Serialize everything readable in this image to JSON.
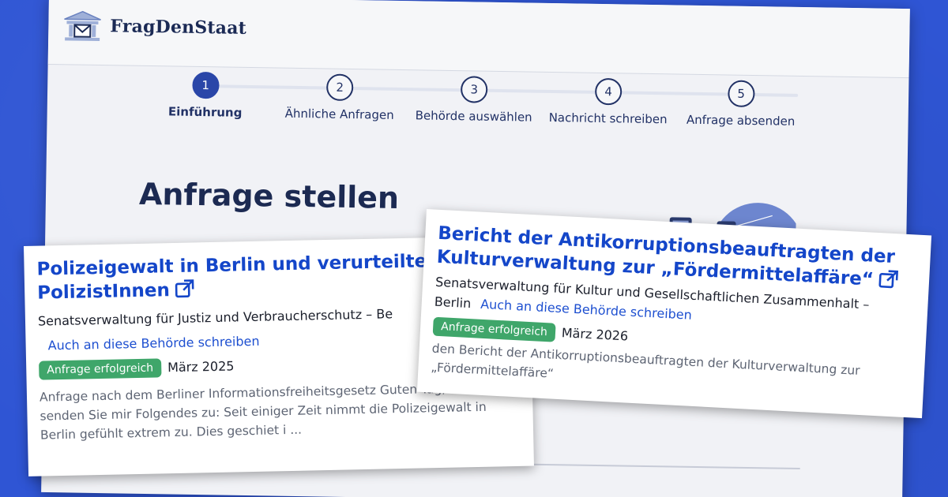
{
  "header": {
    "logo_text": "FragDenStaat",
    "logo_icon": "building-mail-icon"
  },
  "steps": [
    {
      "number": "1",
      "label": "Einführung",
      "active": true
    },
    {
      "number": "2",
      "label": "Ähnliche Anfragen",
      "active": false
    },
    {
      "number": "3",
      "label": "Behörde auswählen",
      "active": false
    },
    {
      "number": "4",
      "label": "Nachricht schreiben",
      "active": false
    },
    {
      "number": "5",
      "label": "Anfrage absenden",
      "active": false
    }
  ],
  "page_title": "Anfrage stellen",
  "cards": [
    {
      "title": "Polizeigewalt in Berlin und verurteilte PolizistInnen",
      "authority": "Senatsverwaltung für Justiz und Verbraucherschutz – Be",
      "link": "Auch an diese Behörde schreiben",
      "badge": "Anfrage erfolgreich",
      "date": "März 2025",
      "snippet": "Anfrage nach dem Berliner Informationsfreiheitsgesetz Guten Tag,  bitte senden Sie mir Folgendes zu:  Seit einiger Zeit nimmt die Polizeigewalt in Berlin gefühlt extrem zu. Dies geschiet i ..."
    },
    {
      "title": "Bericht der Antikorruptionsbeauftragten der Kulturverwaltung zur „Fördermittelaffäre“",
      "authority": "Senatsverwaltung für Kultur und Gesellschaftlichen Zusammenhalt –",
      "authority_city": "Berlin",
      "link": "Auch an diese Behörde schreiben",
      "badge": "Anfrage erfolgreich",
      "date": "März 2026",
      "snippet": "den Bericht der Antikorruptionsbeauftragten der Kulturverwaltung zur „Fördermittelaffäre“"
    }
  ],
  "colors": {
    "background": "#2f55d4",
    "link": "#1446c9",
    "badge": "#3fa66a",
    "active_step": "#2a46a8"
  }
}
